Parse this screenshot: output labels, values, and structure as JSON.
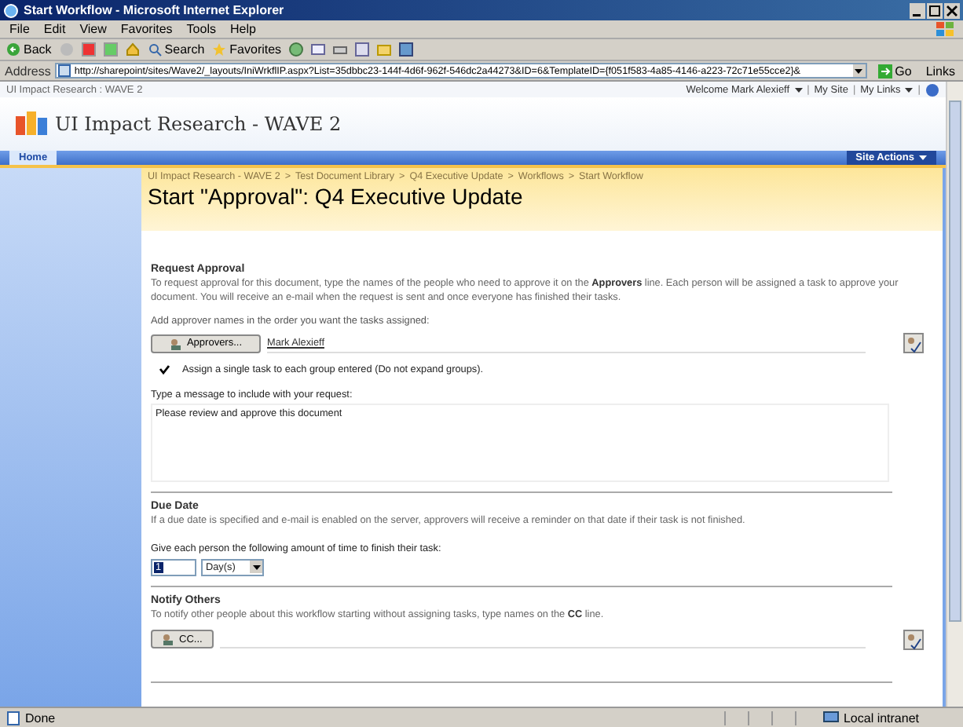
{
  "window": {
    "title": "Start Workflow - Microsoft Internet Explorer"
  },
  "menu": [
    "File",
    "Edit",
    "View",
    "Favorites",
    "Tools",
    "Help"
  ],
  "toolbar": {
    "back": "Back",
    "search": "Search",
    "favorites": "Favorites"
  },
  "address": {
    "label": "Address",
    "value": "http://sharepoint/sites/Wave2/_layouts/IniWrkflIP.aspx?List=35dbbc23-144f-4d6f-962f-546dc2a44273&ID=6&TemplateID={f051f583-4a85-4146-a223-72c71e55cce2}&",
    "go": "Go",
    "links": "Links"
  },
  "site": {
    "crumb": "UI Impact Research : WAVE 2",
    "welcome": "Welcome Mark Alexieff",
    "my_site": "My Site",
    "my_links": "My Links",
    "title": "UI Impact Research - WAVE 2",
    "home_tab": "Home",
    "site_actions": "Site Actions",
    "separator": "|"
  },
  "breadcrumb": {
    "separator": ">",
    "items": [
      "UI Impact Research - WAVE 2",
      "Test Document Library",
      "Q4 Executive Update",
      "Workflows",
      "Start Workflow"
    ]
  },
  "page_title": "Start \"Approval\": Q4 Executive Update",
  "request": {
    "heading": "Request Approval",
    "description": "To request approval for this document, type the names of the people who need to approve it on the **Approvers** line.  Each person will be assigned a task to approve your document. You will receive an e-mail when the request is sent and once everyone has finished their tasks.",
    "order_label": "Add approver names in the order you want the tasks assigned:",
    "approvers_button": "Approvers...",
    "approver": "Mark Alexieff",
    "single_task": {
      "label": "Assign a single task to each group entered (Do not expand groups).",
      "checked": true
    },
    "message_label": "Type a message to include with your request:",
    "message": "Please review and approve this document"
  },
  "due": {
    "heading": "Due Date",
    "description": "If a due date is specified and e-mail is enabled on the server, approvers will receive a reminder on that date if their task is not finished.",
    "time_label": "Give each person the following amount of time to finish their task:",
    "amount": "1",
    "unit": "Day(s)"
  },
  "notify": {
    "heading": "Notify Others",
    "description": "To notify other people about this workflow starting without assigning tasks, type names on the **CC** line.",
    "cc_button": "CC..."
  },
  "status_bar": {
    "status": "Done",
    "zone": "Local intranet"
  }
}
